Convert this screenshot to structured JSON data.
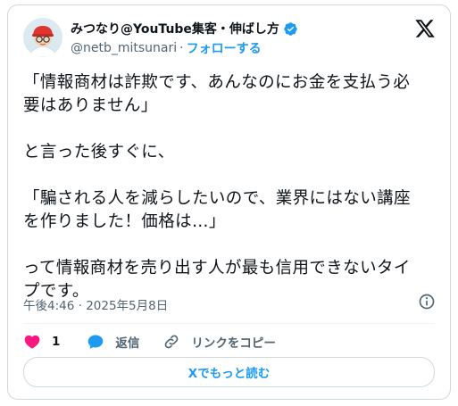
{
  "author": {
    "display_name": "みつなり@YouTube集客・伸ばし方",
    "handle": "@netb_mitsunari",
    "separator": "·",
    "follow_label": "フォローする",
    "verified": true
  },
  "tweet": {
    "lines": [
      "「情報商材は詐欺です、あんなのにお金を支払う必",
      "要はありません」",
      "",
      "と言った後すぐに、",
      "",
      "「騙される人を減らしたいので、業界にはない講座",
      "を作りました！価格は…」",
      "",
      "って情報商材を売り出す人が最も信用できないタイ",
      "プです。"
    ],
    "timestamp": "午後4:46 · 2025年5月8日"
  },
  "actions": {
    "like_count": "1",
    "reply_label": "返信",
    "copy_link_label": "リンクをコピー"
  },
  "read_more_label": "Xでもっと読む",
  "colors": {
    "accent": "#1d9bf0",
    "like": "#f91880",
    "text": "#0f1419",
    "muted": "#536471",
    "border": "#cfd9de"
  },
  "icons": [
    "verified-badge-icon",
    "x-logo-icon",
    "info-icon",
    "heart-icon",
    "reply-bubble-icon",
    "link-icon"
  ]
}
